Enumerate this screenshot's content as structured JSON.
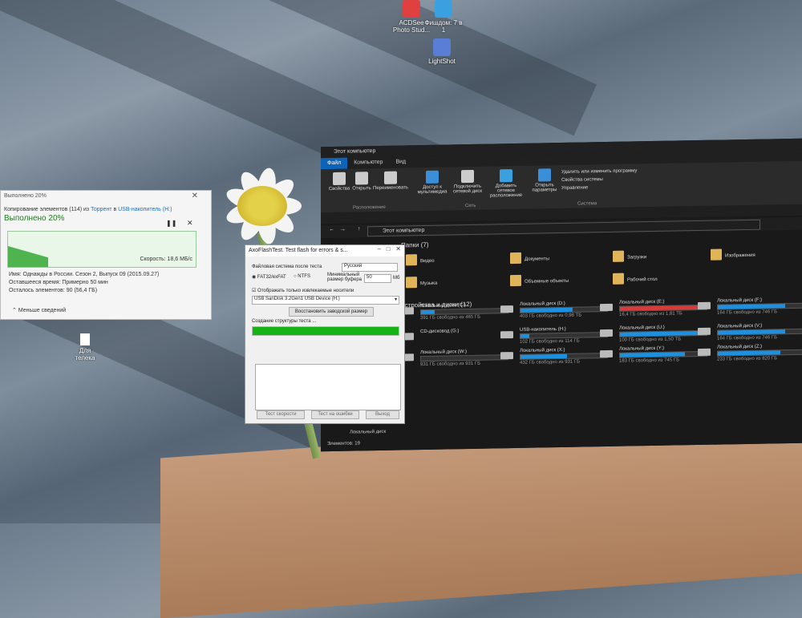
{
  "desktop": {
    "icons": [
      {
        "label": "ACDSee Photo Stud...",
        "color": "#e04040"
      },
      {
        "label": "Фишдом: 7 в 1",
        "color": "#3aa0e0"
      },
      {
        "label": "LightShot",
        "color": "#5a7ed6"
      }
    ],
    "file_label": "Для телека"
  },
  "copy_dialog": {
    "title": "Выполнено 20%",
    "header_prefix": "Копирование элементов (114) из",
    "source": "Торрент",
    "header_mid": "в",
    "destination": "USB-накопитель (H:)",
    "percent_label": "Выполнено 20%",
    "speed": "Скорость: 18,6 МБ/с",
    "progress": 0.2,
    "name_line": "Имя: Однажды в России. Сезон 2, Выпуск 09 (2015.09.27)",
    "time_line": "Оставшееся время: Примерно 50 мин",
    "remaining_line": "Осталось элементов: 90 (56,4 ГБ)",
    "less_label": "Меньше сведений"
  },
  "explorer": {
    "title": "Этот компьютер",
    "tabs": [
      "Файл",
      "Компьютер",
      "Вид"
    ],
    "ribbon": [
      {
        "label": "Свойства"
      },
      {
        "label": "Открыть"
      },
      {
        "label": "Переименовать"
      },
      {
        "label": "Доступ к мультимедиа"
      },
      {
        "label": "Подключить сетевой диск"
      },
      {
        "label": "Добавить сетевое расположение"
      },
      {
        "label": "Открыть параметры"
      }
    ],
    "ribbon_side": [
      "Удалить или изменить программу",
      "Свойства системы",
      "Управление"
    ],
    "groups": [
      "Расположение",
      "Сеть",
      "Система"
    ],
    "address": "Этот компьютер",
    "folders_title": "Папки (7)",
    "folders": [
      "Видео",
      "Документы",
      "Загрузки",
      "Изображения",
      "Музыка",
      "Объемные объекты",
      "Рабочий стол"
    ],
    "drives_title": "Устройства и диски (12)",
    "drives": [
      {
        "name": "Локальный диск (C:)",
        "free": "391 ГБ свободно из 465 ГБ",
        "used": 0.16
      },
      {
        "name": "Локальный диск (D:)",
        "free": "403 ГБ свободно из 0,98 ТБ",
        "used": 0.6
      },
      {
        "name": "Локальный диск (E:)",
        "free": "16,4 ГБ свободно из 1,81 ТБ",
        "used": 0.99,
        "color": "#d83b3b"
      },
      {
        "name": "Локальный диск (F:)",
        "free": "164 ГБ свободно из 746 ГБ",
        "used": 0.78
      },
      {
        "name": "CD-дисковод (G:)",
        "free": "",
        "used": 0
      },
      {
        "name": "USB-накопитель (H:)",
        "free": "102 ГБ свободно из 114 ГБ",
        "used": 0.1
      },
      {
        "name": "Локальный диск (U:)",
        "free": "100 ГБ свободно из 1,50 ТБ",
        "used": 0.93
      },
      {
        "name": "Локальный диск (V:)",
        "free": "164 ГБ свободно из 746 ГБ",
        "used": 0.78
      },
      {
        "name": "Локальный диск (W:)",
        "free": "931 ГБ свободно из 931 ГБ",
        "used": 0.0
      },
      {
        "name": "Локальный диск (X:)",
        "free": "432 ГБ свободно из 931 ГБ",
        "used": 0.54
      },
      {
        "name": "Локальный диск (Y:)",
        "free": "183 ГБ свободно из 745 ГБ",
        "used": 0.75
      },
      {
        "name": "Локальный диск (Z:)",
        "free": "233 ГБ свободно из 820 ГБ",
        "used": 0.72
      }
    ],
    "extra_item": "Локальный диск",
    "status": "Элементов: 19"
  },
  "axo": {
    "title": "AxoFlashTest. Test flash for errors & s...",
    "fs_label": "Файловая система после теста",
    "lang": "Русский",
    "fat_label": "FAT32/exFAT",
    "ntfs_label": "NTFS",
    "buffer_label": "Минимальный размер буфера",
    "buffer_value": "50",
    "buffer_unit": "Мб",
    "removable_label": "Отображать только извлекаемые носители",
    "device": "USB  SanDisk 3.2Gen1 USB Device (H:)",
    "restore_label": "Восстановить заводской размер",
    "status_label": "Создание структуры теста ...",
    "progress": 1.0,
    "btn_speed": "Тест скорости",
    "btn_errors": "Тест на ошибки",
    "btn_exit": "Выход"
  }
}
